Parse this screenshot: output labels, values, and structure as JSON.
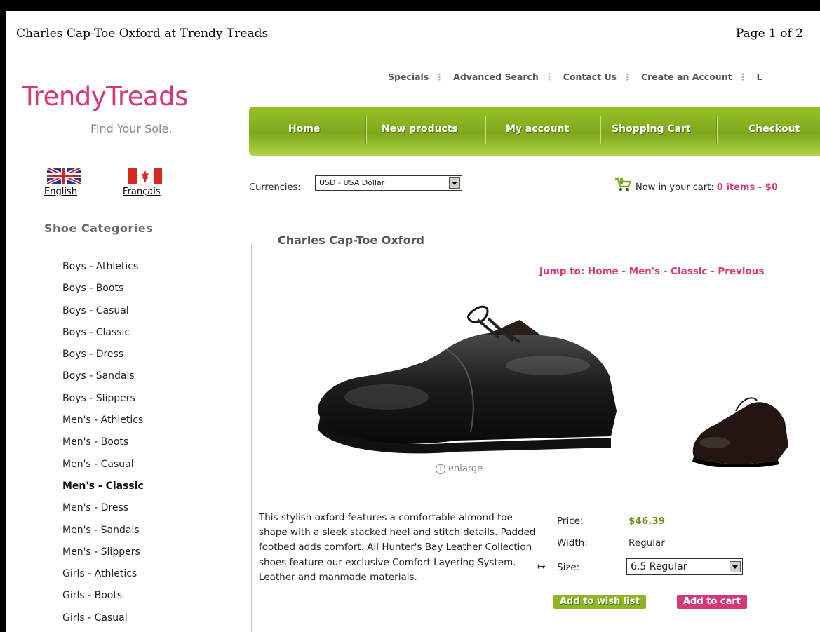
{
  "print": {
    "title": "Charles Cap-Toe Oxford at Trendy Treads",
    "page": "Page 1 of 2"
  },
  "brand": {
    "logo": "TrendyTreads",
    "tagline": "Find Your Sole."
  },
  "toplinks": [
    "Specials",
    "Advanced Search",
    "Contact Us",
    "Create an Account",
    "L"
  ],
  "nav": [
    "Home",
    "New products",
    "My account",
    "Shopping Cart",
    "Checkout"
  ],
  "languages": [
    "English",
    "Français"
  ],
  "categories": {
    "title": "Shoe Categories",
    "items": [
      "Boys - Athletics",
      "Boys - Boots",
      "Boys - Casual",
      "Boys - Classic",
      "Boys - Dress",
      "Boys - Sandals",
      "Boys - Slippers",
      "Men's - Athletics",
      "Men's - Boots",
      "Men's - Casual",
      "Men's - Classic",
      "Men's - Dress",
      "Men's - Sandals",
      "Men's - Slippers",
      "Girls - Athletics",
      "Girls - Boots",
      "Girls - Casual"
    ],
    "active": "Men's - Classic"
  },
  "currency": {
    "label": "Currencies:",
    "selected": "USD - USA Dollar"
  },
  "cart": {
    "label": "Now in your cart:",
    "summary": "0 items - $0"
  },
  "product": {
    "name": "Charles Cap-Toe Oxford",
    "jump": "Jump to: Home - Men's - Classic - Previous",
    "enlarge": "enlarge",
    "description": "This stylish oxford features a comfortable almond toe shape with a sleek stacked heel and stitch details. Padded footbed adds comfort. All Hunter's Bay Leather Collection shoes feature our exclusive Comfort Layering System. Leather and manmade materials.",
    "price_label": "Price:",
    "price": "$46.39",
    "width_label": "Width:",
    "width": "Regular",
    "size_label": "Size:",
    "size": "6.5 Regular",
    "wishlist_button": "Add to wish list",
    "cart_button": "Add to cart"
  },
  "colors": {
    "brand_pink": "#d4397a",
    "nav_green": "#8fb526"
  },
  "icons": [
    "flag-uk-icon",
    "flag-canada-icon",
    "cart-icon",
    "enlarge-icon",
    "chevron-down-icon"
  ]
}
